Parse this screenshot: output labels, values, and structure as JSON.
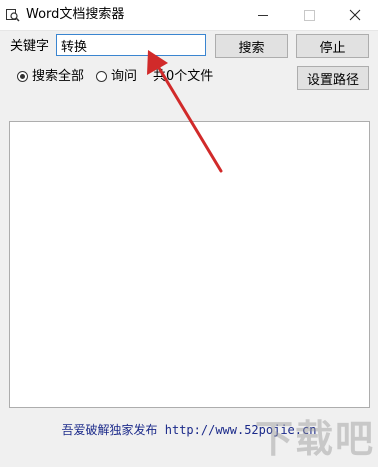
{
  "window": {
    "title": "Word文档搜索器"
  },
  "search": {
    "keyword_label": "关键字",
    "keyword_value": "转换",
    "search_button": "搜索",
    "stop_button": "停止",
    "set_path_button": "设置路径"
  },
  "options": {
    "search_all_label": "搜索全部",
    "search_all_checked": true,
    "ask_label": "询问",
    "ask_checked": false
  },
  "status": {
    "file_count": "共0个文件"
  },
  "footer": {
    "text": "吾爱破解独家发布 http://www.52pojie.cn"
  },
  "watermark": {
    "text": "下载吧"
  },
  "colors": {
    "annotation_arrow": "#d12a2a",
    "footer_text": "#1b2a8a",
    "input_border": "#3a85d0"
  }
}
